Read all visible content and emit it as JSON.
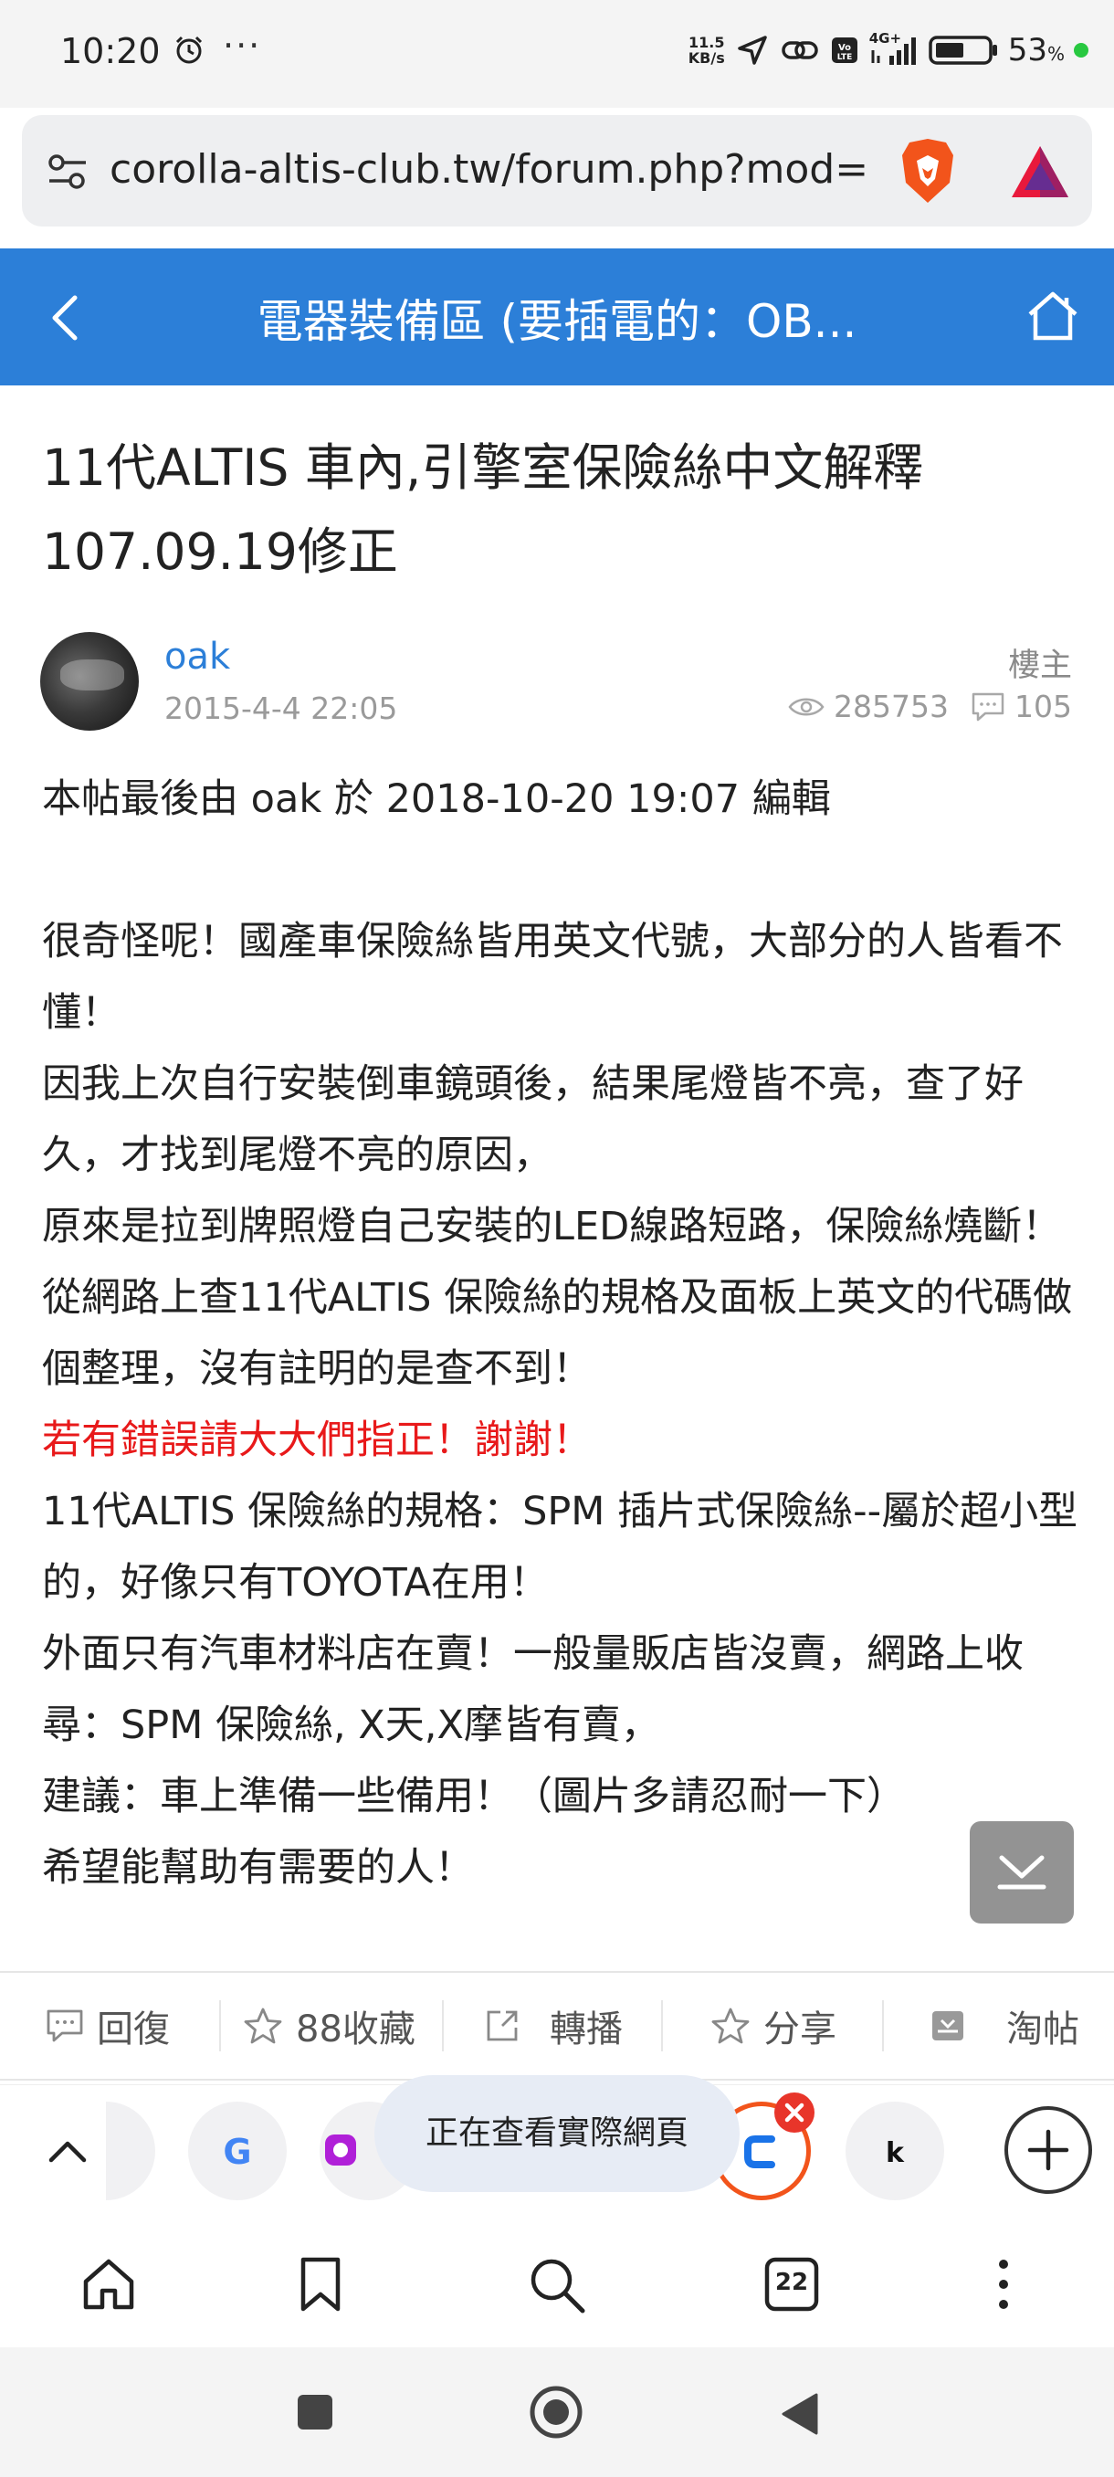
{
  "status_bar": {
    "time": "10:20",
    "more": "···",
    "speed_value": "11.5",
    "speed_unit": "KB/s",
    "network": "4G+",
    "battery": "53",
    "battery_unit": "%"
  },
  "url_bar": {
    "url": "corolla-altis-club.tw/forum.php?mod=v"
  },
  "forum_header": {
    "section_title": "電器裝備區 (要插電的：OB..."
  },
  "post": {
    "title": "11代ALTIS 車內,引擎室保險絲中文解釋 107.09.19修正",
    "author": "oak",
    "date": "2015-4-4 22:05",
    "role": "樓主",
    "views": "285753",
    "replies": "105",
    "edit_note": "本帖最後由 oak 於 2018-10-20 19:07 編輯",
    "paragraphs": [
      "很奇怪呢！國產車保險絲皆用英文代號，大部分的人皆看不懂！",
      "因我上次自行安裝倒車鏡頭後，結果尾燈皆不亮，查了好久，才找到尾燈不亮的原因，",
      "原來是拉到牌照燈自己安裝的LED線路短路，保險絲燒斷！",
      "從網路上查11代ALTIS 保險絲的規格及面板上英文的代碼做個整理，沒有註明的是查不到！"
    ],
    "highlight": "若有錯誤請大大們指正！謝謝！",
    "paragraphs_after": [
      "11代ALTIS 保險絲的規格：SPM 插片式保險絲--屬於超小型的，好像只有TOYOTA在用！",
      "外面只有汽車材料店在賣！一般量販店皆沒賣，網路上收尋：SPM 保險絲, X天,X摩皆有賣，",
      "建議：車上準備一些備用！（圖片多請忍耐一下）",
      "希望能幫助有需要的人！"
    ]
  },
  "actions": {
    "reply": "回復",
    "favorite": "88收藏",
    "repost": "轉播",
    "share": "分享",
    "trash": "淘帖"
  },
  "tab_strip": {
    "toast": "正在查看實際網頁"
  },
  "bottom_nav": {
    "tab_count": "22"
  },
  "colors": {
    "forum_blue": "#2c7fd8",
    "highlight_red": "#e8191a"
  }
}
